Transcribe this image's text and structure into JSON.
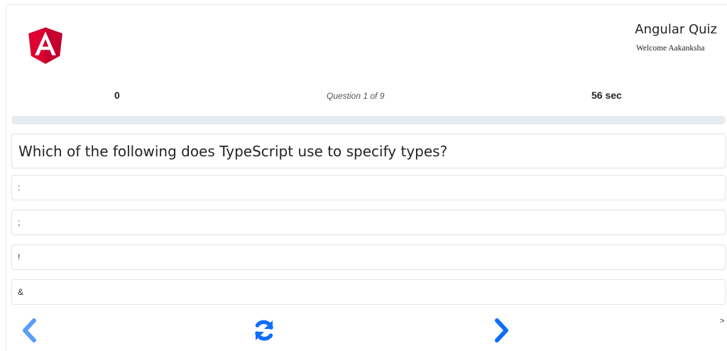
{
  "header": {
    "logo": "angular-logo",
    "title": "Angular Quiz",
    "welcome": "Welcome Aakanksha"
  },
  "stats": {
    "score": "0",
    "question_counter": "Question 1 of 9",
    "timer": "56 sec"
  },
  "progress": {
    "fraction": 0
  },
  "question": {
    "text": "Which of the following does TypeScript use to specify types?",
    "options": [
      ":",
      ";",
      "!",
      "&"
    ]
  },
  "navigation": {
    "previous_icon": "chevron-left-icon",
    "restart_icon": "refresh-icon",
    "next_icon": "chevron-right-icon",
    "small_next_label": ">"
  },
  "colors": {
    "angular_red": "#dd0031",
    "angular_dark_red": "#c3002f",
    "primary_blue": "#0d6efd",
    "light_blue": "#5a9cf8"
  }
}
